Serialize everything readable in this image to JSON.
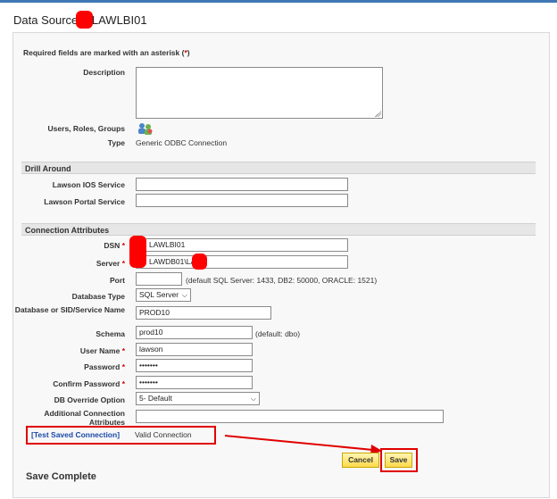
{
  "header": {
    "title_prefix": "Data Source",
    "title_name": "LAWLBI01"
  },
  "form": {
    "required_note": "Required fields are marked with an asterisk (",
    "required_star": "*",
    "required_close": ")",
    "description_label": "Description",
    "description_value": "",
    "users_roles_groups_label": "Users, Roles, Groups",
    "type_label": "Type",
    "type_value": "Generic ODBC Connection"
  },
  "drill_around": {
    "header": "Drill Around",
    "ios_label": "Lawson IOS Service",
    "ios_value": "",
    "portal_label": "Lawson Portal Service",
    "portal_value": ""
  },
  "connection": {
    "header": "Connection Attributes",
    "dsn_label": "DSN",
    "dsn_value": "LAWLBI01",
    "server_label": "Server",
    "server_value": "LAWDB01\\LA",
    "port_label": "Port",
    "port_value": "",
    "port_hint": "(default SQL Server: 1433, DB2: 50000, ORACLE: 1521)",
    "dbtype_label": "Database Type",
    "dbtype_value": "SQL Server",
    "sid_label": "Database or SID/Service Name",
    "sid_value": "PROD10",
    "schema_label": "Schema",
    "schema_value": "prod10",
    "schema_hint": "(default: dbo)",
    "username_label": "User Name",
    "username_value": "lawson",
    "password_label": "Password",
    "password_value": "•••••••",
    "confirm_label": "Confirm Password",
    "confirm_value": "•••••••",
    "override_label": "DB Override Option",
    "override_value": "5- Default",
    "additional_label": "Additional Connection Attributes",
    "additional_value": "",
    "star": "*"
  },
  "test": {
    "link_label": "[Test Saved Connection]",
    "status": "Valid Connection"
  },
  "buttons": {
    "cancel": "Cancel",
    "save": "Save"
  },
  "status_message": "Save Complete",
  "colors": {
    "accent_blue": "#1a47a8",
    "highlight_red": "#e00000",
    "button_yellow": "#ffd94a"
  }
}
